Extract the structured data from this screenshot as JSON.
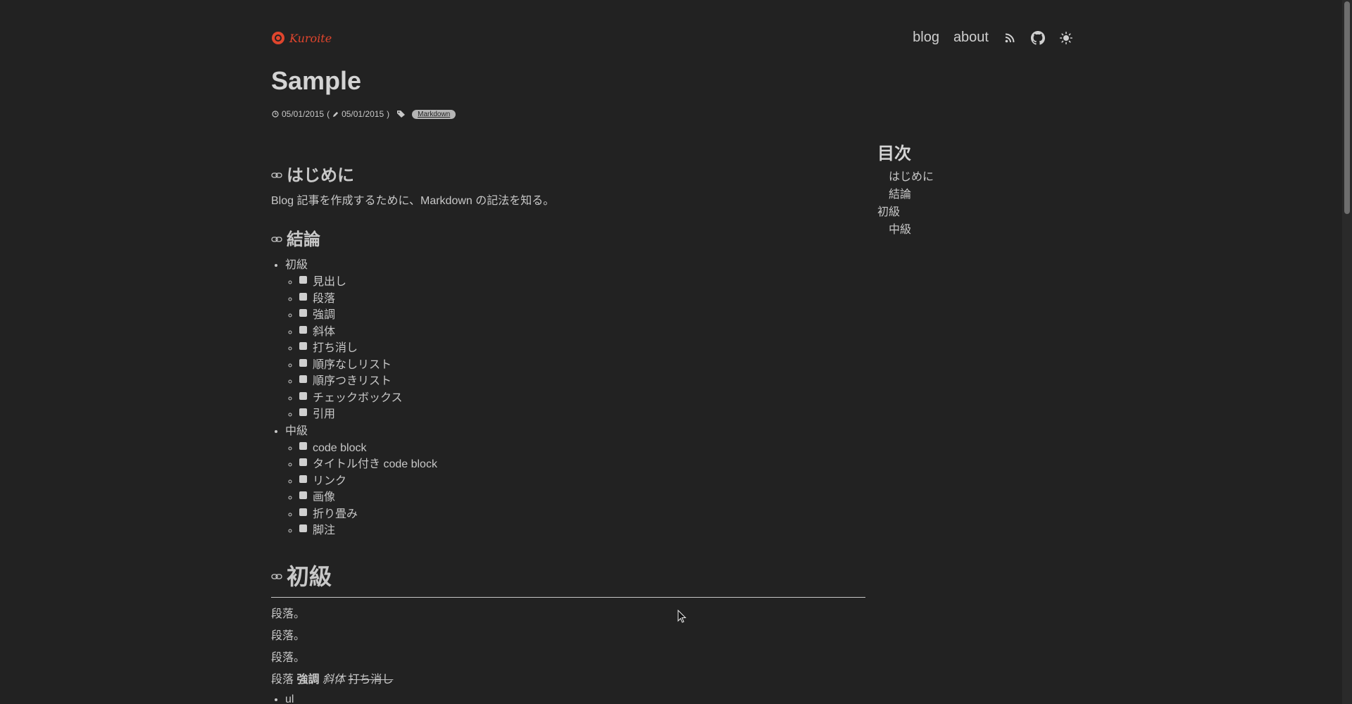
{
  "header": {
    "logo_text": "Kuroite",
    "nav": {
      "blog": "blog",
      "about": "about",
      "rss_icon": "rss-icon",
      "github_icon": "github-icon",
      "theme_icon": "sun-icon"
    }
  },
  "post": {
    "title": "Sample",
    "created": "05/01/2015",
    "updated": "05/01/2015",
    "tag": "Markdown"
  },
  "sections": {
    "intro": {
      "heading": "はじめに",
      "text": "Blog 記事を作成するために、Markdown の記法を知る。"
    },
    "conclusion": {
      "heading": "結論",
      "groups": [
        {
          "label": "初級",
          "items": [
            "見出し",
            "段落",
            "強調",
            "斜体",
            "打ち消し",
            "順序なしリスト",
            "順序つきリスト",
            "チェックボックス",
            "引用"
          ]
        },
        {
          "label": "中級",
          "items": [
            "code block",
            "タイトル付き code block",
            "リンク",
            "画像",
            "折り畳み",
            "脚注"
          ]
        }
      ]
    },
    "beginner": {
      "heading": "初級",
      "paragraphs": [
        "段落。",
        "段落。",
        "段落。"
      ],
      "mixed": {
        "plain": "段落 ",
        "strong": "強調",
        "em": "斜体",
        "del": "打ち消し"
      },
      "list_first": "ul"
    }
  },
  "toc": {
    "title": "目次",
    "items": [
      {
        "label": "はじめに",
        "level": 2
      },
      {
        "label": "結論",
        "level": 2
      },
      {
        "label": "初級",
        "level": 1
      },
      {
        "label": "中級",
        "level": 2
      }
    ]
  },
  "colors": {
    "background": "#222222",
    "text": "#c8c8c8",
    "brand": "#e0452d"
  }
}
